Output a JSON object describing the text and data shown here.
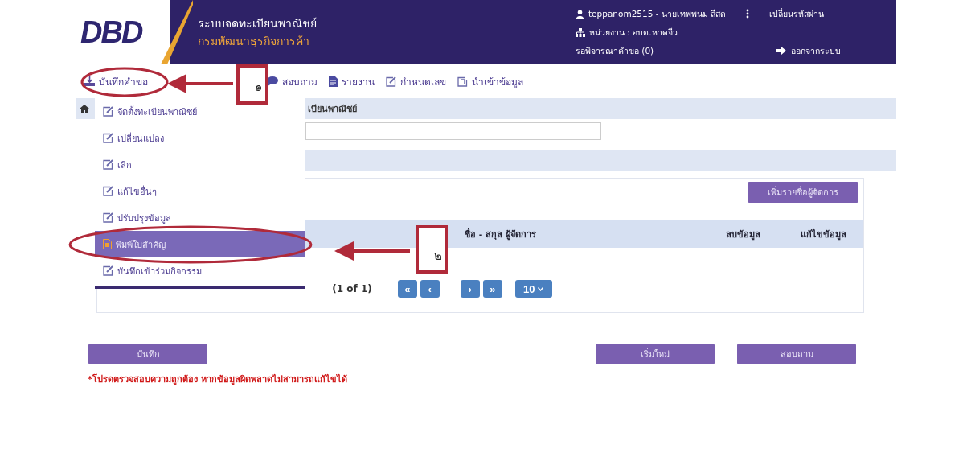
{
  "header": {
    "logo": "DBD",
    "system_name": "ระบบจดทะเบียนพาณิชย์",
    "department": "กรมพัฒนาธุรกิจการค้า",
    "user": "teppanom2515 - นายเทพพนม ลีสด",
    "change_password": "เปลี่ยนรหัสผ่าน",
    "unit": "หน่วยงาน : อบต.หาดจีว",
    "pending": "รอพิจารณาคำขอ (0)",
    "logout": "ออกจากระบบ"
  },
  "menu": [
    {
      "label": "บันทึกคำขอ",
      "kind": "download"
    },
    {
      "label": "สอบถาม",
      "kind": "chat"
    },
    {
      "label": "รายงาน",
      "kind": "document"
    },
    {
      "label": "กำหนดเลข",
      "kind": "edit"
    },
    {
      "label": "นำเข้าข้อมูล",
      "kind": "import"
    }
  ],
  "dropdown": [
    {
      "label": "จัดตั้งทะเบียนพาณิชย์",
      "selected": false
    },
    {
      "label": "เปลี่ยนแปลง",
      "selected": false
    },
    {
      "label": "เลิก",
      "selected": false
    },
    {
      "label": "แก้ไขอื่นๆ",
      "selected": false
    },
    {
      "label": "ปรับปรุงข้อมูล",
      "selected": false
    },
    {
      "label": "พิมพ์ใบสำคัญ",
      "selected": true
    },
    {
      "label": "บันทึกเข้าร่วมกิจกรรม",
      "selected": false
    }
  ],
  "panel": {
    "title": "เบียนพาณิชย์",
    "add_button": "เพิ่มรายชื่อผู้จัดการ",
    "table": {
      "columns": [
        "ชื่อ - สกุล ผู้จัดการ",
        "ลบข้อมูล",
        "แก้ไขข้อมูล"
      ]
    },
    "pagination": {
      "summary": "(1 of 1)",
      "first": "«",
      "prev": "‹",
      "next": "›",
      "last": "»",
      "page_size": "10"
    }
  },
  "actions": {
    "save": "บันทึก",
    "reset": "เริ่มใหม่",
    "inquire": "สอบถาม"
  },
  "note": "*โปรดตรวจสอบความถูกต้อง หากข้อมูลผิดพลาดไม่สามารถแก้ไขได้",
  "annotations": [
    {
      "number": "๑"
    },
    {
      "number": "๒"
    }
  ]
}
